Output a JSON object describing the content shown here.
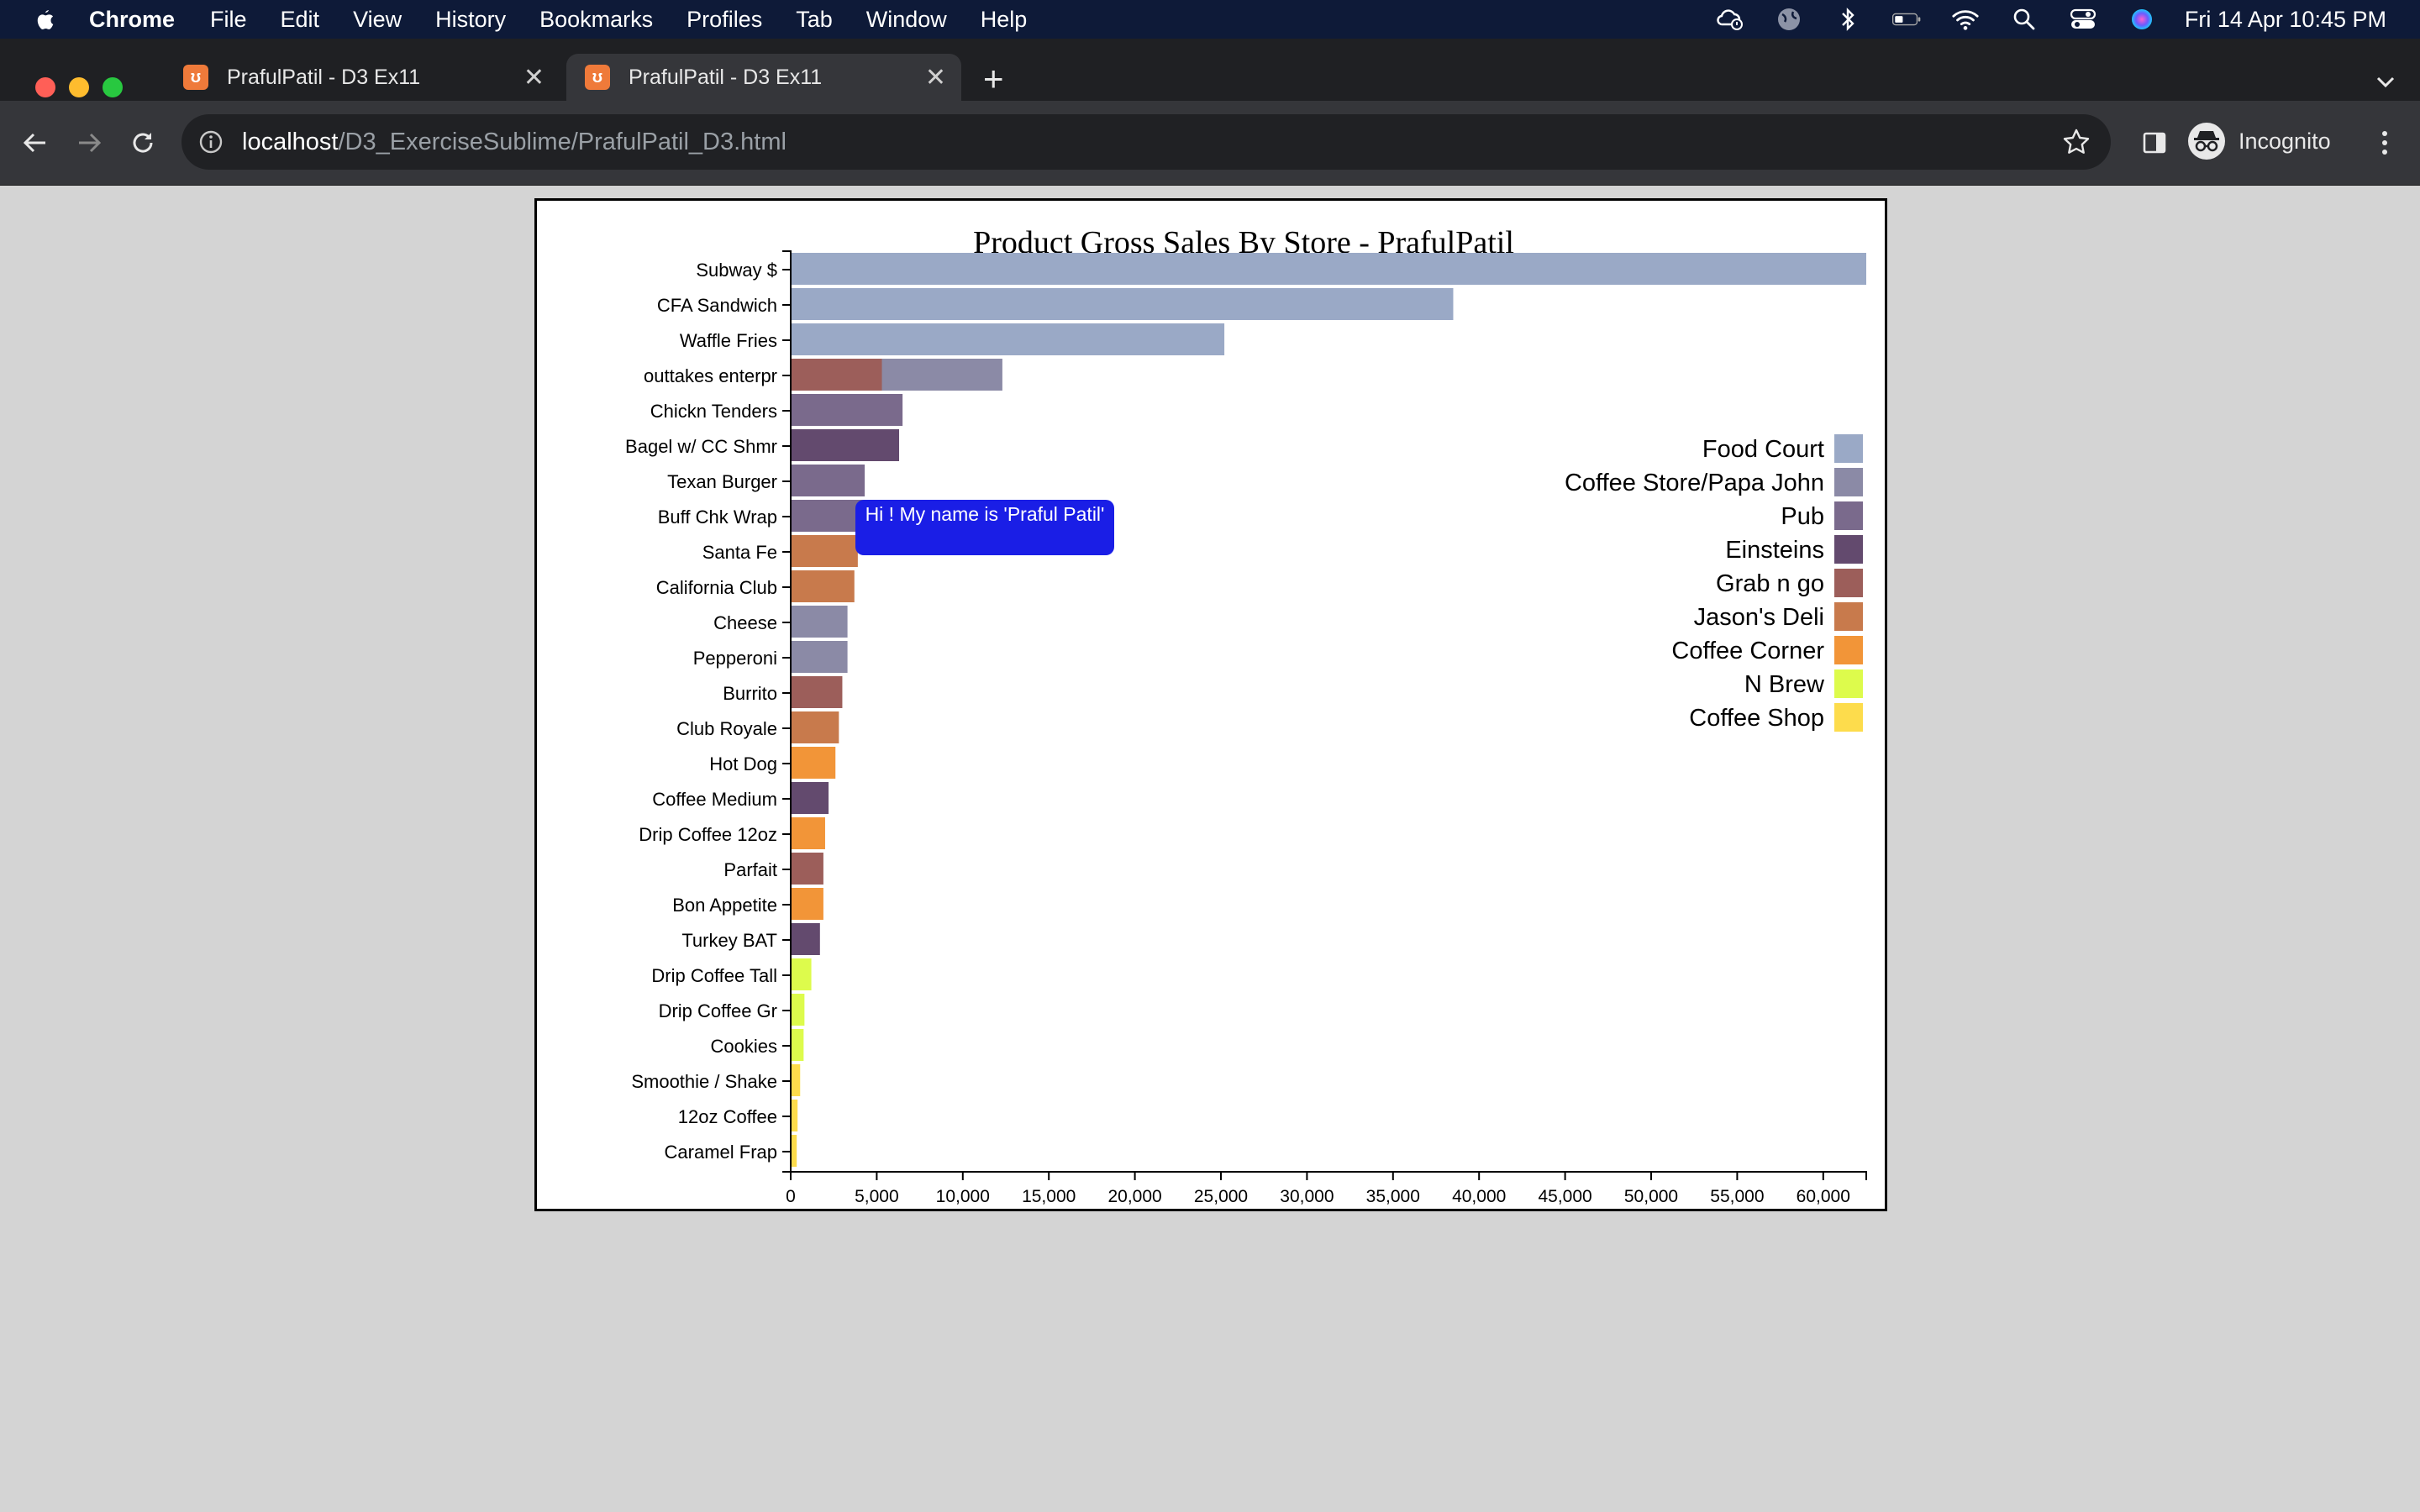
{
  "menubar": {
    "app_name": "Chrome",
    "items": [
      "File",
      "Edit",
      "View",
      "History",
      "Bookmarks",
      "Profiles",
      "Tab",
      "Window",
      "Help"
    ],
    "clock": "Fri 14 Apr  10:45 PM"
  },
  "browser": {
    "tabs": [
      {
        "title": "PrafulPatil - D3 Ex11",
        "active": false
      },
      {
        "title": "PrafulPatil - D3 Ex11",
        "active": true
      }
    ],
    "url_host": "localhost",
    "url_path": "/D3_ExerciseSublime/PrafulPatil_D3.html",
    "profile_label": "Incognito"
  },
  "tooltip": {
    "text": "Hi ! My name is 'Praful Patil'"
  },
  "chart_data": {
    "type": "bar",
    "orientation": "horizontal",
    "title": "Product Gross Sales By Store - PrafulPatil",
    "xlim": [
      0,
      62500
    ],
    "x_ticks": [
      0,
      5000,
      10000,
      15000,
      20000,
      25000,
      30000,
      35000,
      40000,
      45000,
      50000,
      55000,
      60000
    ],
    "x_tick_labels": [
      "0",
      "5,000",
      "10,000",
      "15,000",
      "20,000",
      "25,000",
      "30,000",
      "35,000",
      "40,000",
      "45,000",
      "50,000",
      "55,000",
      "60,000"
    ],
    "categories": [
      "Subway $",
      "CFA Sandwich",
      "Waffle Fries",
      "outtakes enterpr",
      "Chickn Tenders",
      "Bagel w/ CC Shmr",
      "Texan Burger",
      "Buff Chk Wrap",
      "Santa Fe",
      "California Club",
      "Cheese",
      "Pepperoni",
      "Burrito",
      "Club Royale",
      "Hot Dog",
      "Coffee Medium",
      "Drip Coffee 12oz",
      "Parfait",
      "Bon Appetite",
      "Turkey BAT",
      "Drip Coffee Tall",
      "Drip Coffee Gr",
      "Cookies",
      "Smoothie / Shake",
      "12oz Coffee",
      "Caramel Frap"
    ],
    "values": [
      62500,
      38500,
      25200,
      12300,
      6500,
      6300,
      4300,
      4300,
      3900,
      3700,
      3300,
      3300,
      3000,
      2800,
      2600,
      2200,
      2000,
      1900,
      1900,
      1700,
      1200,
      800,
      750,
      550,
      400,
      350
    ],
    "stores": [
      "Food Court",
      "Food Court",
      "Food Court",
      "Coffee Store/Papa John",
      "Pub",
      "Einsteins",
      "Pub",
      "Pub",
      "Jason's Deli",
      "Jason's Deli",
      "Coffee Store/Papa John",
      "Coffee Store/Papa John",
      "Grab n go",
      "Jason's Deli",
      "Coffee Corner",
      "Einsteins",
      "Coffee Corner",
      "Grab n go",
      "Coffee Corner",
      "Einsteins",
      "N Brew",
      "N Brew",
      "N Brew",
      "Coffee Shop",
      "Coffee Shop",
      "Coffee Shop"
    ],
    "overlay_bar": {
      "category": "outtakes enterpr",
      "store": "Grab n go",
      "value": 5300
    },
    "legend": {
      "position": "right",
      "entries": [
        {
          "name": "Food Court",
          "color": "#9aa9c6"
        },
        {
          "name": "Coffee Store/Papa John",
          "color": "#8b8aa6"
        },
        {
          "name": "Pub",
          "color": "#7a6a8c"
        },
        {
          "name": "Einsteins",
          "color": "#634a6e"
        },
        {
          "name": "Grab n go",
          "color": "#9c5e5a"
        },
        {
          "name": "Jason's Deli",
          "color": "#c87a4c"
        },
        {
          "name": "Coffee Corner",
          "color": "#f29538"
        },
        {
          "name": "N Brew",
          "color": "#ddfb4c"
        },
        {
          "name": "Coffee Shop",
          "color": "#fddc4c"
        }
      ]
    }
  }
}
